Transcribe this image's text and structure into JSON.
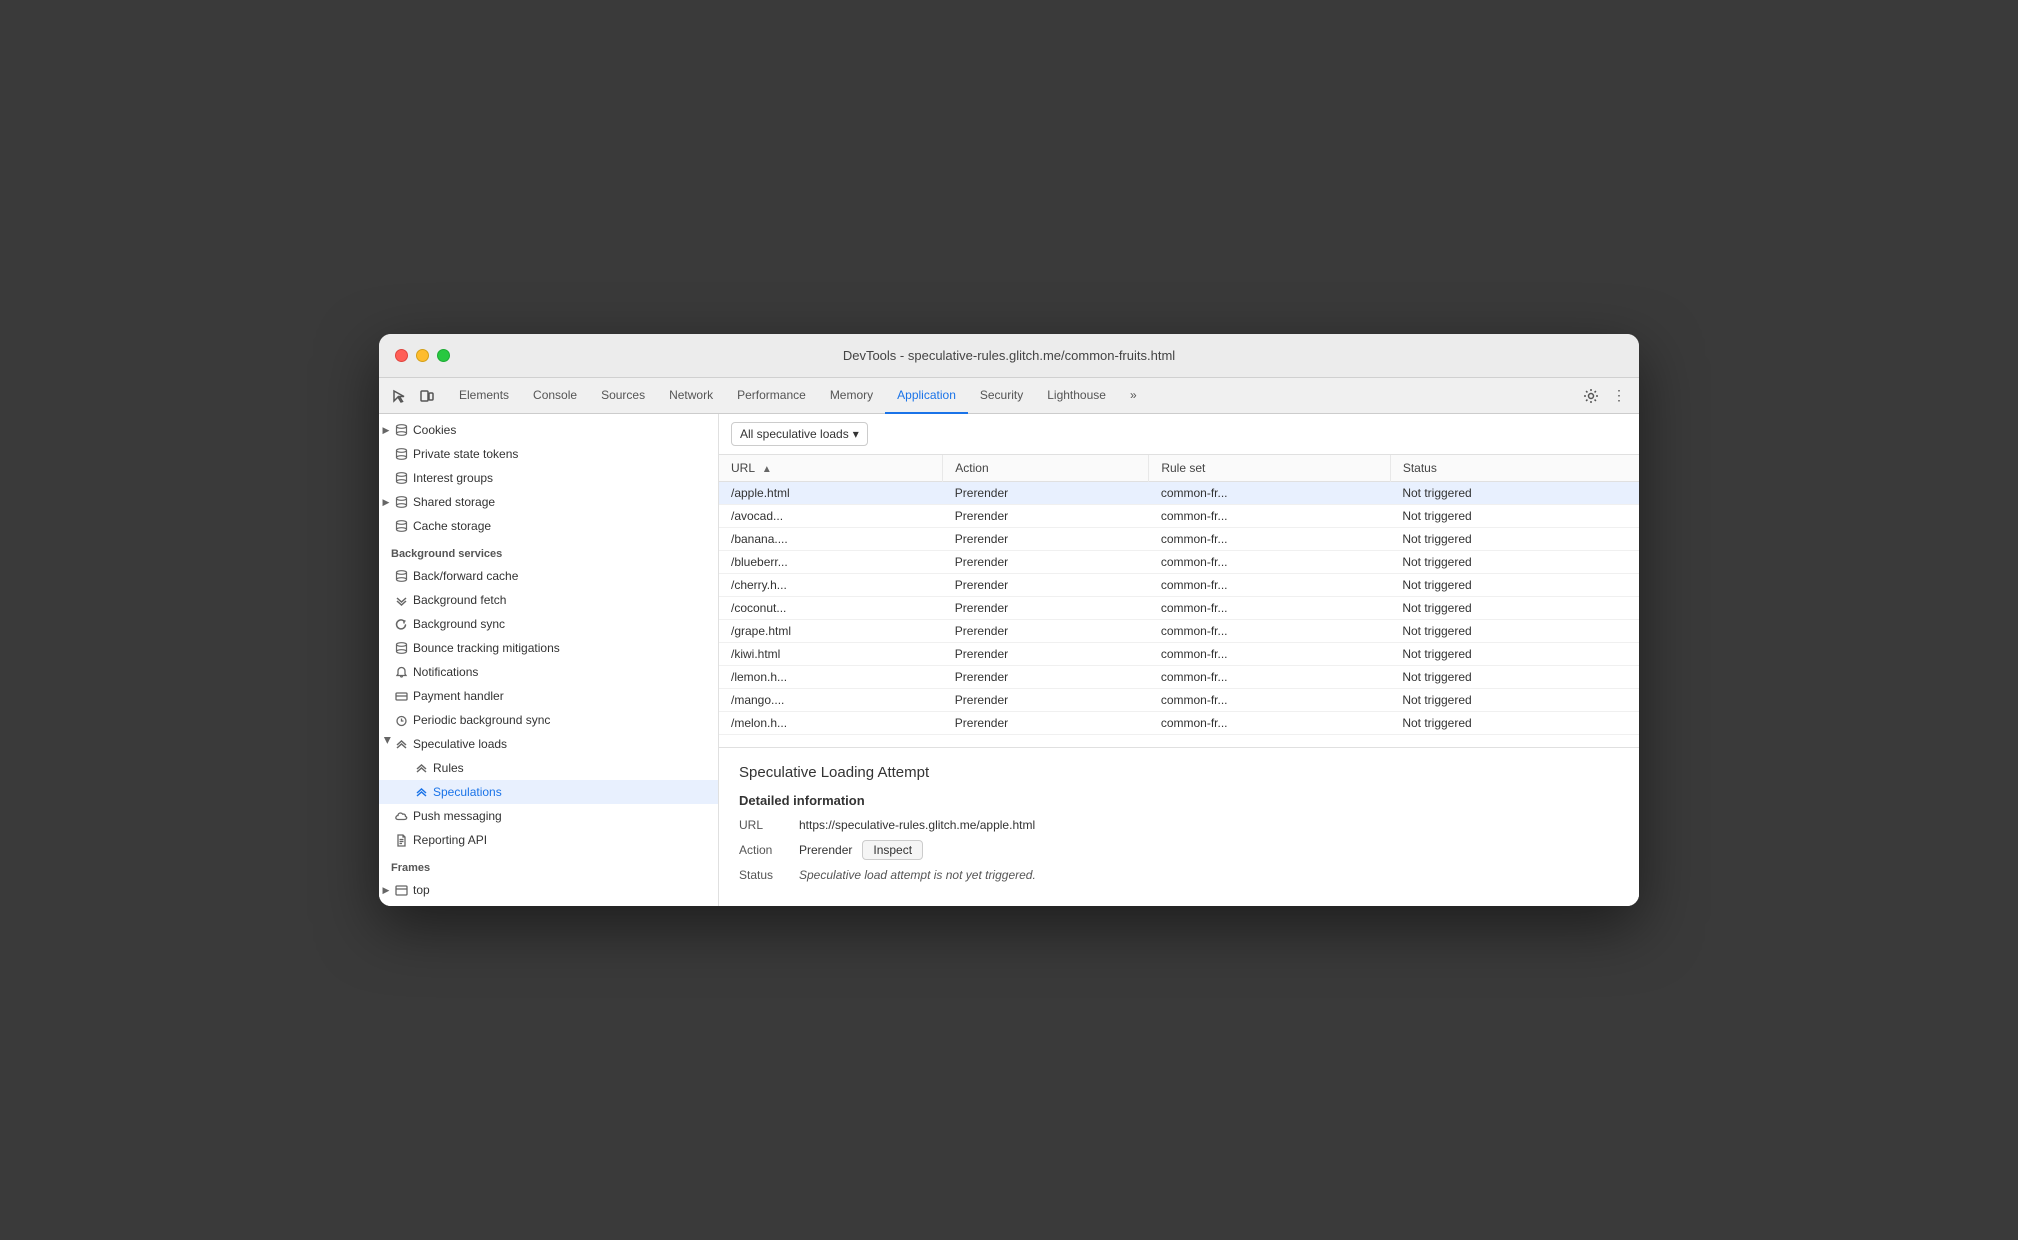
{
  "window": {
    "title": "DevTools - speculative-rules.glitch.me/common-fruits.html"
  },
  "tabs": {
    "items": [
      {
        "id": "elements",
        "label": "Elements",
        "active": false
      },
      {
        "id": "console",
        "label": "Console",
        "active": false
      },
      {
        "id": "sources",
        "label": "Sources",
        "active": false
      },
      {
        "id": "network",
        "label": "Network",
        "active": false
      },
      {
        "id": "performance",
        "label": "Performance",
        "active": false
      },
      {
        "id": "memory",
        "label": "Memory",
        "active": false
      },
      {
        "id": "application",
        "label": "Application",
        "active": true
      },
      {
        "id": "security",
        "label": "Security",
        "active": false
      },
      {
        "id": "lighthouse",
        "label": "Lighthouse",
        "active": false
      }
    ]
  },
  "sidebar": {
    "sections": [
      {
        "items": [
          {
            "id": "cookies",
            "label": "Cookies",
            "icon": "triangle-right-cylinder",
            "indent": 1,
            "expandable": true
          },
          {
            "id": "private-state-tokens",
            "label": "Private state tokens",
            "icon": "cylinder",
            "indent": 1
          },
          {
            "id": "interest-groups",
            "label": "Interest groups",
            "icon": "cylinder",
            "indent": 1
          },
          {
            "id": "shared-storage",
            "label": "Shared storage",
            "icon": "triangle-right-cylinder",
            "indent": 1,
            "expandable": true
          },
          {
            "id": "cache-storage",
            "label": "Cache storage",
            "icon": "cylinder",
            "indent": 1
          }
        ]
      },
      {
        "header": "Background services",
        "items": [
          {
            "id": "back-forward-cache",
            "label": "Back/forward cache",
            "icon": "cylinder",
            "indent": 1
          },
          {
            "id": "background-fetch",
            "label": "Background fetch",
            "icon": "arrow-down-up",
            "indent": 1
          },
          {
            "id": "background-sync",
            "label": "Background sync",
            "icon": "sync",
            "indent": 1
          },
          {
            "id": "bounce-tracking",
            "label": "Bounce tracking mitigations",
            "icon": "cylinder",
            "indent": 1
          },
          {
            "id": "notifications",
            "label": "Notifications",
            "icon": "bell",
            "indent": 1
          },
          {
            "id": "payment-handler",
            "label": "Payment handler",
            "icon": "card",
            "indent": 1
          },
          {
            "id": "periodic-background-sync",
            "label": "Periodic background sync",
            "icon": "clock",
            "indent": 1
          },
          {
            "id": "speculative-loads",
            "label": "Speculative loads",
            "icon": "arrow-down-up",
            "indent": 1,
            "expandable": true,
            "expanded": true
          },
          {
            "id": "rules",
            "label": "Rules",
            "icon": "arrow-down-up",
            "indent": 2
          },
          {
            "id": "speculations",
            "label": "Speculations",
            "icon": "arrow-down-up",
            "indent": 2,
            "selected": true
          },
          {
            "id": "push-messaging",
            "label": "Push messaging",
            "icon": "cloud",
            "indent": 1
          },
          {
            "id": "reporting-api",
            "label": "Reporting API",
            "icon": "doc",
            "indent": 1
          }
        ]
      },
      {
        "header": "Frames",
        "items": [
          {
            "id": "top",
            "label": "top",
            "icon": "frame-expand",
            "indent": 1,
            "expandable": true
          }
        ]
      }
    ]
  },
  "toolbar": {
    "filter_label": "All speculative loads",
    "filter_arrow": "▾"
  },
  "table": {
    "columns": [
      {
        "id": "url",
        "label": "URL",
        "sortable": true
      },
      {
        "id": "action",
        "label": "Action"
      },
      {
        "id": "ruleset",
        "label": "Rule set"
      },
      {
        "id": "status",
        "label": "Status"
      }
    ],
    "rows": [
      {
        "url": "/apple.html",
        "action": "Prerender",
        "ruleset": "common-fr...",
        "status": "Not triggered",
        "selected": true
      },
      {
        "url": "/avocad...",
        "action": "Prerender",
        "ruleset": "common-fr...",
        "status": "Not triggered"
      },
      {
        "url": "/banana....",
        "action": "Prerender",
        "ruleset": "common-fr...",
        "status": "Not triggered"
      },
      {
        "url": "/blueberr...",
        "action": "Prerender",
        "ruleset": "common-fr...",
        "status": "Not triggered"
      },
      {
        "url": "/cherry.h...",
        "action": "Prerender",
        "ruleset": "common-fr...",
        "status": "Not triggered"
      },
      {
        "url": "/coconut...",
        "action": "Prerender",
        "ruleset": "common-fr...",
        "status": "Not triggered"
      },
      {
        "url": "/grape.html",
        "action": "Prerender",
        "ruleset": "common-fr...",
        "status": "Not triggered"
      },
      {
        "url": "/kiwi.html",
        "action": "Prerender",
        "ruleset": "common-fr...",
        "status": "Not triggered"
      },
      {
        "url": "/lemon.h...",
        "action": "Prerender",
        "ruleset": "common-fr...",
        "status": "Not triggered"
      },
      {
        "url": "/mango....",
        "action": "Prerender",
        "ruleset": "common-fr...",
        "status": "Not triggered"
      },
      {
        "url": "/melon.h...",
        "action": "Prerender",
        "ruleset": "common-fr...",
        "status": "Not triggered"
      }
    ]
  },
  "detail": {
    "title": "Speculative Loading Attempt",
    "subtitle": "Detailed information",
    "url_label": "URL",
    "url_value": "https://speculative-rules.glitch.me/apple.html",
    "action_label": "Action",
    "action_value": "Prerender",
    "inspect_label": "Inspect",
    "status_label": "Status",
    "status_value": "Speculative load attempt is not yet triggered."
  }
}
